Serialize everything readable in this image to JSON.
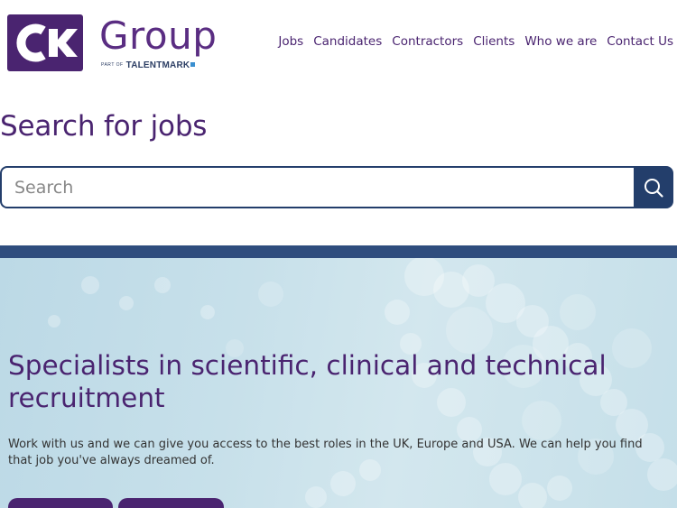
{
  "brand": {
    "logo_word": "Group",
    "logo_sub_prefix": "PART OF",
    "logo_sub_name": "TALENTMARK"
  },
  "nav": {
    "items": [
      {
        "label": "Jobs"
      },
      {
        "label": "Candidates"
      },
      {
        "label": "Contractors"
      },
      {
        "label": "Clients"
      },
      {
        "label": "Who we are"
      },
      {
        "label": "Contact Us"
      }
    ]
  },
  "search": {
    "title": "Search for jobs",
    "placeholder": "Search",
    "button_icon": "search-icon"
  },
  "hero": {
    "title": "Specialists in scientific, clinical and technical recruitment",
    "text": "Work with us and we can give you access to the best roles in the UK, Europe and USA. We can help you find that job you've always dreamed of."
  },
  "colors": {
    "brand_purple": "#4a2470",
    "navy": "#233e6b",
    "hero_bar": "#2f4d7e"
  }
}
